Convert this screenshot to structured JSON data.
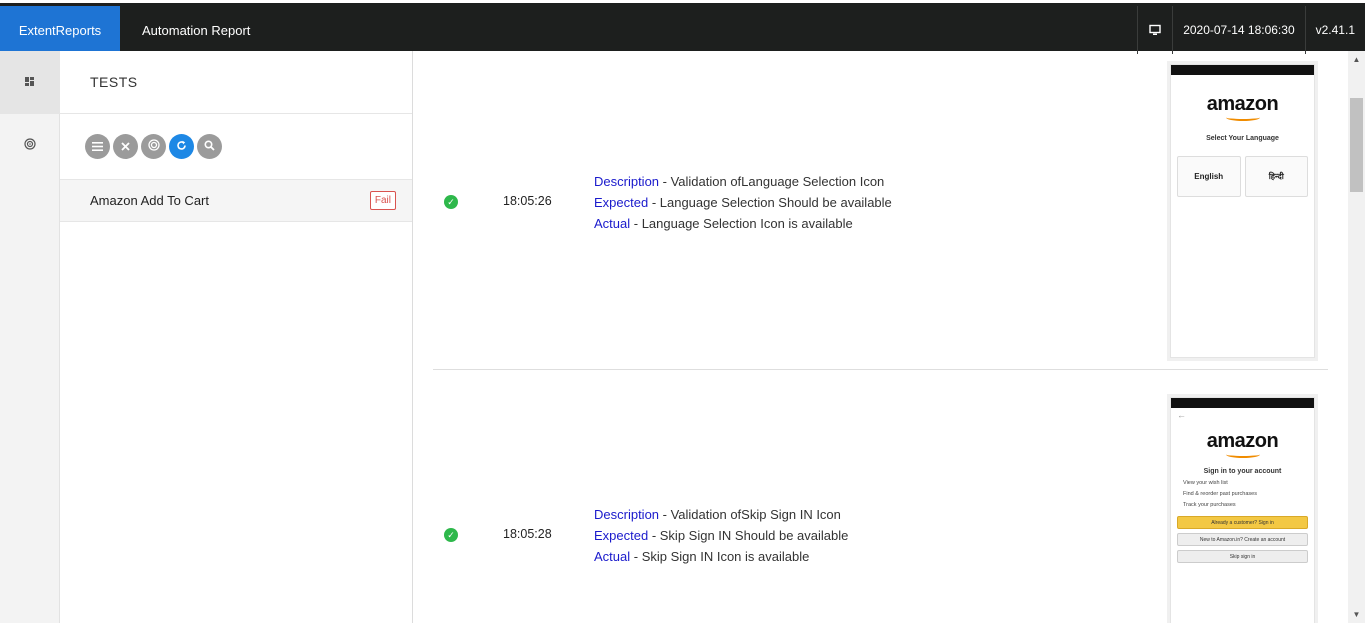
{
  "header": {
    "brand": "ExtentReports",
    "report_name": "Automation Report",
    "timestamp": "2020-07-14 18:06:30",
    "version": "v2.41.1"
  },
  "left_nav": {
    "items": [
      {
        "icon": "dashboard-icon"
      },
      {
        "icon": "category-icon"
      }
    ]
  },
  "test_panel": {
    "title": "TESTS",
    "filters": [
      {
        "icon": "list-icon"
      },
      {
        "icon": "close-icon"
      },
      {
        "icon": "radar-icon"
      },
      {
        "icon": "refresh-icon"
      },
      {
        "icon": "search-icon"
      }
    ],
    "tests": [
      {
        "name": "Amazon Add To Cart",
        "status": "Fail"
      }
    ]
  },
  "steps": [
    {
      "status": "pass",
      "time": "18:05:26",
      "description_key": "Description",
      "description": " - Validation ofLanguage Selection Icon",
      "expected_key": "Expected",
      "expected": " - Language Selection Should be available",
      "actual_key": "Actual",
      "actual": " - Language Selection Icon is available",
      "screenshot": {
        "logo": "amazon",
        "heading": "Select Your Language",
        "options": [
          "English",
          "हिन्दी"
        ]
      }
    },
    {
      "status": "pass",
      "time": "18:05:28",
      "description_key": "Description",
      "description": " - Validation ofSkip Sign IN Icon",
      "expected_key": "Expected",
      "expected": " - Skip Sign IN Should be available",
      "actual_key": "Actual",
      "actual": " - Skip Sign IN Icon is available",
      "screenshot": {
        "logo": "amazon",
        "heading": "Sign in to your account",
        "lines": [
          "View your wish list",
          "Find & reorder past purchases",
          "Track your purchases"
        ],
        "buttons": [
          "Already a customer? Sign in",
          "New to Amazon.in? Create an account",
          "Skip sign in"
        ]
      }
    }
  ],
  "colors": {
    "brand_bg": "#1e74d4",
    "topbar_bg": "#1d1f1e",
    "pass": "#2eb84b",
    "fail": "#d9534f",
    "key_text": "#1a1acc"
  }
}
